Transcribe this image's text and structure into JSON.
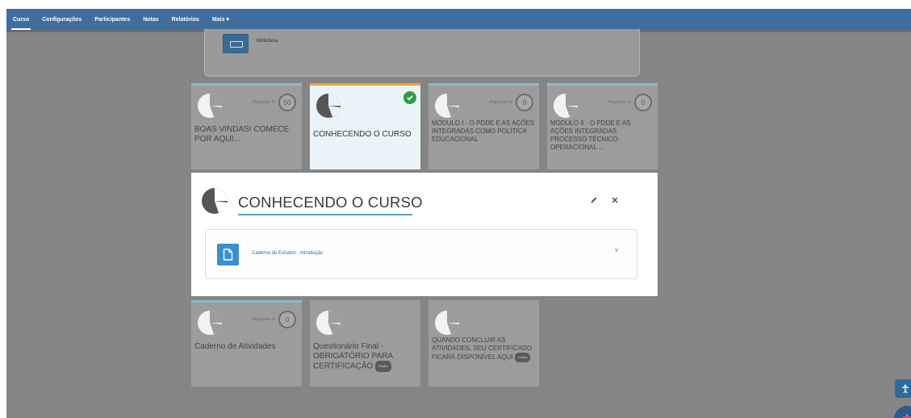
{
  "nav": {
    "items": [
      "Curso",
      "Configurações",
      "Participantes",
      "Notas",
      "Relatórios",
      "Mais ▾"
    ]
  },
  "library": {
    "label": "Biblioteca"
  },
  "progress_label": "Progresso %",
  "tiles": [
    {
      "title": "BOAS VINDAS! COMECE POR AQUI...",
      "progress": "50"
    },
    {
      "title": "CONHECENDO O CURSO",
      "completed": true
    },
    {
      "title": "MÓDULO I - O PDDE E AS AÇÕES INTEGRADAS COMO POLÍTICA EDUCACIONAL",
      "progress": "0"
    },
    {
      "title": "MÓDULO II - O PDDE E AS AÇÕES INTEGRADAS PROCESSO TÉCNICO-OPERACIONAL ...",
      "progress": "0"
    },
    {
      "title": "Caderno de Atividades",
      "progress": "0"
    },
    {
      "title": "Questionário Final - OBRIGATÓRIO PARA CERTIFICAÇÃO",
      "badge": "Oculto"
    },
    {
      "title": "QUANDO CONCLUIR AS ATIVIDADES, SEU CERTIFICADO FICARÁ DISPONÍVEL AQUI",
      "badge": "Oculto"
    }
  ],
  "modal": {
    "title": "CONHECENDO O CURSO",
    "activity_label": "Caderno de Estudos - Introdução"
  },
  "colors": {
    "navbar": "#3f6e9e",
    "overlay": "#858585",
    "accent_blue": "#5aa1d3",
    "active_border": "#f3a23a",
    "check_green": "#2e9c4a"
  }
}
